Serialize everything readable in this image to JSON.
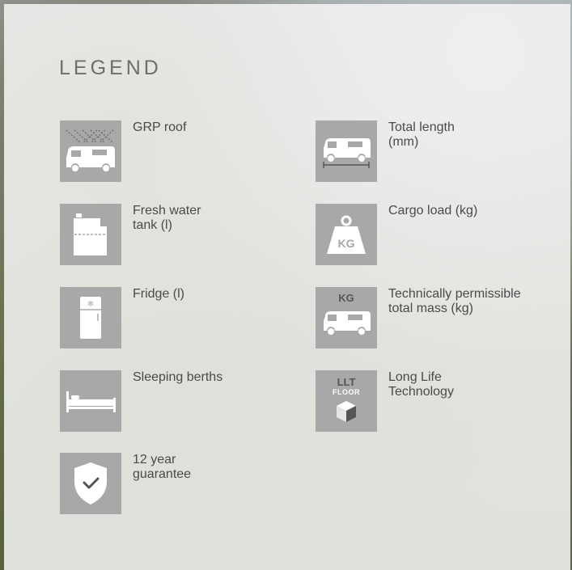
{
  "legend": {
    "title": "LEGEND",
    "items": [
      {
        "label": "GRP roof",
        "icon": "grp-roof-icon"
      },
      {
        "label": "Total length\n(mm)",
        "icon": "total-length-icon"
      },
      {
        "label": "Fresh water\ntank (l)",
        "icon": "fresh-water-tank-icon"
      },
      {
        "label": "Cargo load (kg)",
        "icon": "cargo-load-weight-icon"
      },
      {
        "label": "Fridge (l)",
        "icon": "fridge-icon"
      },
      {
        "label": "Technically permissible\ntotal mass (kg)",
        "icon": "total-mass-icon"
      },
      {
        "label": "Sleeping berths",
        "icon": "bed-icon"
      },
      {
        "label": "Long Life\nTechnology",
        "icon": "llt-floor-icon"
      },
      {
        "label": "12 year\nguarantee",
        "icon": "shield-check-icon"
      }
    ],
    "icon_text": {
      "kg": "KG",
      "llt": "LLT",
      "floor": "FLOOR"
    }
  },
  "colors": {
    "icon_bg": "#a8a8a8",
    "icon_fg": "#ffffff",
    "text": "#4a4a4a",
    "title": "#6e6e6e"
  }
}
